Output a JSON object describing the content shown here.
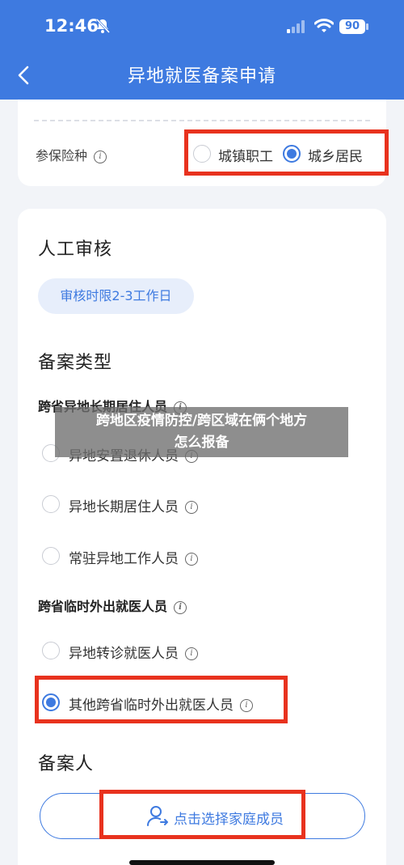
{
  "status_bar": {
    "time": "12:46",
    "battery": "90"
  },
  "navbar": {
    "title": "异地就医备案申请"
  },
  "insurance": {
    "label": "参保险种",
    "options": [
      {
        "label": "城镇职工",
        "selected": false
      },
      {
        "label": "城乡居民",
        "selected": true
      }
    ]
  },
  "review": {
    "title": "人工审核",
    "badge": "审核时限2-3工作日"
  },
  "filing_type": {
    "title": "备案类型",
    "groups": [
      {
        "label": "跨省异地长期居住人员",
        "options": [
          {
            "label": "异地安置退休人员",
            "selected": false
          },
          {
            "label": "异地长期居住人员",
            "selected": false
          },
          {
            "label": "常驻异地工作人员",
            "selected": false
          }
        ]
      },
      {
        "label": "跨省临时外出就医人员",
        "options": [
          {
            "label": "异地转诊就医人员",
            "selected": false
          },
          {
            "label": "其他跨省临时外出就医人员",
            "selected": true
          }
        ]
      }
    ]
  },
  "filer": {
    "title": "备案人",
    "select_button": "点击选择家庭成员"
  },
  "overlay": {
    "line1": "跨地区疫情防控/跨区域在俩个地方",
    "line2": "怎么报备"
  },
  "colors": {
    "accent": "#3e7ae0",
    "highlight_box": "#e8321e"
  }
}
